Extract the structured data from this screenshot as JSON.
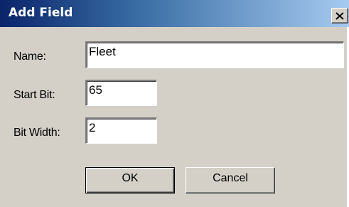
{
  "window": {
    "title": "Add Field"
  },
  "form": {
    "name_label": "Name:",
    "name_value": "Fleet",
    "start_bit_label": "Start Bit:",
    "start_bit_value": "65",
    "bit_width_label": "Bit Width:",
    "bit_width_value": "2"
  },
  "buttons": {
    "ok_label": "OK",
    "cancel_label": "Cancel"
  },
  "icons": {
    "close": "close-icon"
  },
  "colors": {
    "titlebar_start": "#0a246a",
    "titlebar_end": "#a6caf0",
    "dialog_face": "#d4d0c8"
  }
}
